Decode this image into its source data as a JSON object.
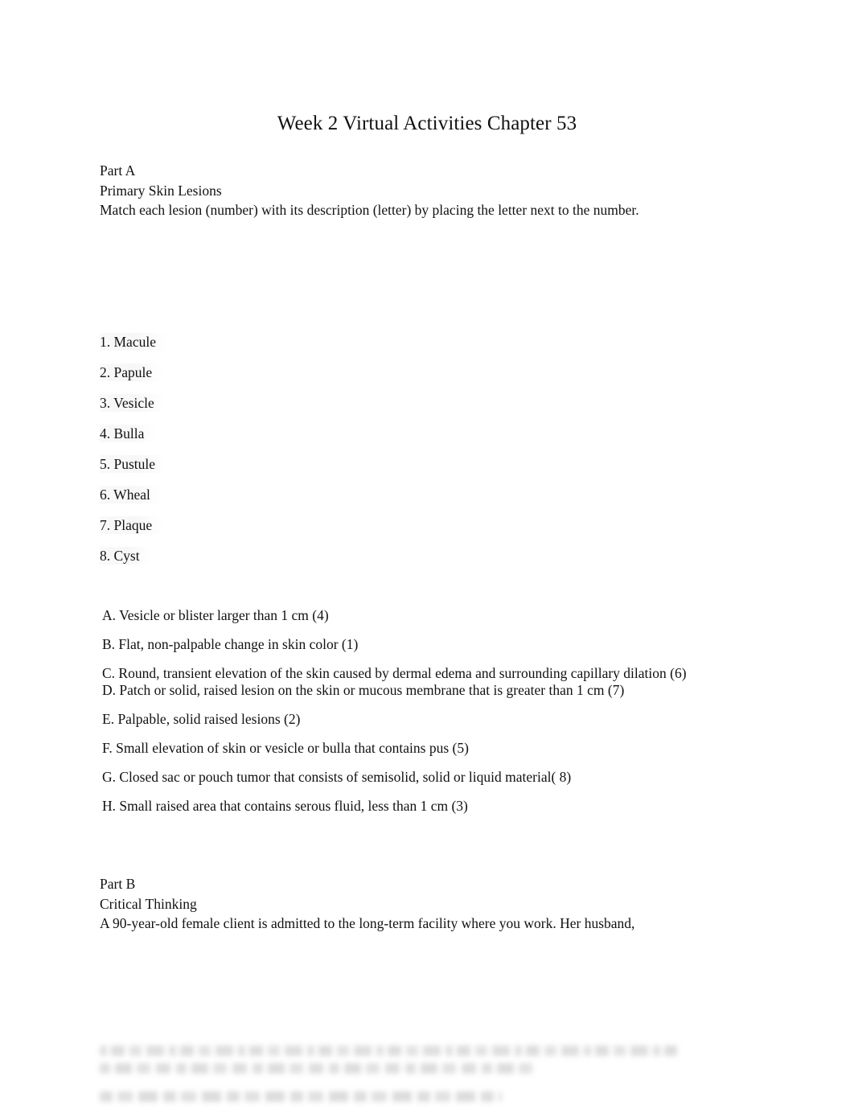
{
  "document": {
    "title": "Week 2 Virtual Activities Chapter 53"
  },
  "part_a": {
    "heading": "Part A",
    "subheading": "Primary Skin Lesions",
    "instruction": "Match each lesion (number) with its description (letter) by placing the letter next to the number.",
    "lesions": [
      {
        "label": "1. Macule"
      },
      {
        "label": "2. Papule"
      },
      {
        "label": "3. Vesicle"
      },
      {
        "label": "4. Bulla"
      },
      {
        "label": "5. Pustule"
      },
      {
        "label": "6. Wheal"
      },
      {
        "label": "7. Plaque"
      },
      {
        "label": "8. Cyst"
      }
    ],
    "descriptions": [
      {
        "text": "A. Vesicle or blister larger than 1 cm (4)"
      },
      {
        "text": "B. Flat, non-palpable change in skin color (1)"
      },
      {
        "text": "C. Round, transient elevation of the skin caused by dermal edema and surrounding capillary dilation (6)"
      },
      {
        "text": "D. Patch or solid, raised lesion on the skin or mucous membrane that is greater than 1 cm (7)"
      },
      {
        "text": "E. Palpable, solid raised lesions (2)"
      },
      {
        "text": "F. Small elevation of skin or vesicle or bulla that contains pus (5)"
      },
      {
        "text": "G. Closed sac or pouch tumor that consists of semisolid, solid or liquid material( 8)"
      },
      {
        "text": "H. Small raised area that contains serous fluid, less than 1 cm (3)"
      }
    ]
  },
  "part_b": {
    "heading": "Part B",
    "subheading": "Critical Thinking",
    "scenario": "A 90-year-old female client is admitted to the long-term facility where you work. Her husband,"
  }
}
